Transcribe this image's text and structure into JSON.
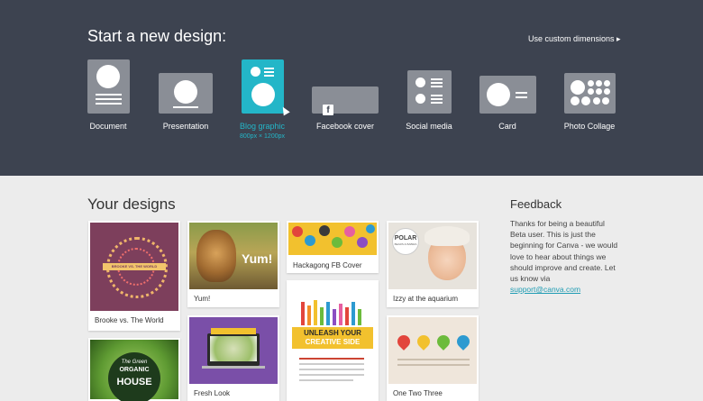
{
  "header": {
    "title": "Start a new design:",
    "custom_dimensions": "Use custom dimensions ▸"
  },
  "templates": [
    {
      "label": "Document"
    },
    {
      "label": "Presentation"
    },
    {
      "label": "Blog graphic",
      "sub": "800px × 1200px"
    },
    {
      "label": "Facebook cover"
    },
    {
      "label": "Social media"
    },
    {
      "label": "Card"
    },
    {
      "label": "Photo Collage"
    }
  ],
  "designs_title": "Your designs",
  "designs": [
    {
      "caption": "Brooke vs. The World",
      "banner": "BROOKE VS. THE WORLD"
    },
    {
      "caption": "Yum!",
      "thumb_text": "Yum!"
    },
    {
      "caption": "Hackagong FB Cover"
    },
    {
      "caption": "Izzy at the aquarium",
      "thumb_text": "POLAR",
      "thumb_sub": "BEARS & BABIES"
    },
    {
      "caption": "",
      "thumb_text": "The Green",
      "thumb_sub": "ORGANIC",
      "thumb_main": "HOUSE"
    },
    {
      "caption": "Fresh Look"
    },
    {
      "caption": "",
      "thumb_text": "UNLEASH YOUR",
      "thumb_sub": "CREATIVE SIDE"
    },
    {
      "caption": "One Two Three"
    }
  ],
  "feedback": {
    "title": "Feedback",
    "text": "Thanks for being a beautiful Beta user. This is just the beginning for Canva - we would love to hear about things we should improve and create. Let us know via",
    "email": "support@canva.com"
  },
  "colors": {
    "header_bg": "#3d4350",
    "accent": "#23b6c8",
    "card": "#8a8e96"
  }
}
